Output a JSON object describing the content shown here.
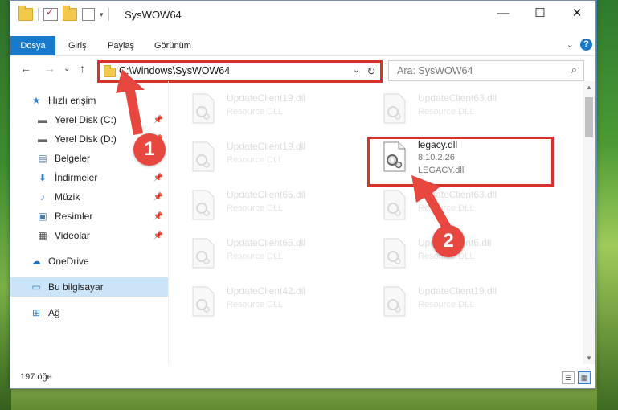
{
  "window": {
    "title": "SysWOW64",
    "controls": {
      "minimize": "—",
      "maximize": "☐",
      "close": "✕"
    }
  },
  "ribbon": {
    "tabs": [
      "Dosya",
      "Giriş",
      "Paylaş",
      "Görünüm"
    ],
    "expand_glyph": "⌄",
    "help_glyph": "?"
  },
  "navigation": {
    "back": "←",
    "forward": "→",
    "recent": "⌄",
    "up": "↑",
    "address": "C:\\Windows\\SysWOW64",
    "address_dropdown": "⌄",
    "refresh": "↻",
    "search_placeholder": "Ara: SysWOW64",
    "search_glyph": "⌕"
  },
  "sidebar": {
    "items": [
      {
        "label": "Hızlı erişim",
        "icon": "star-icon",
        "glyph": "★",
        "pinned": false,
        "selected": false
      },
      {
        "label": "Yerel Disk (C:)",
        "icon": "drive-icon",
        "glyph": "▬",
        "pinned": true,
        "selected": false
      },
      {
        "label": "Yerel Disk (D:)",
        "icon": "drive-icon",
        "glyph": "▬",
        "pinned": true,
        "selected": false
      },
      {
        "label": "Belgeler",
        "icon": "documents-icon",
        "glyph": "▤",
        "pinned": true,
        "selected": false
      },
      {
        "label": "İndirmeler",
        "icon": "downloads-icon",
        "glyph": "⬇",
        "pinned": true,
        "selected": false
      },
      {
        "label": "Müzik",
        "icon": "music-icon",
        "glyph": "♪",
        "pinned": true,
        "selected": false
      },
      {
        "label": "Resimler",
        "icon": "pictures-icon",
        "glyph": "▣",
        "pinned": true,
        "selected": false
      },
      {
        "label": "Videolar",
        "icon": "videos-icon",
        "glyph": "▦",
        "pinned": true,
        "selected": false
      },
      {
        "label": "OneDrive",
        "icon": "onedrive-icon",
        "glyph": "☁",
        "pinned": false,
        "selected": false
      },
      {
        "label": "Bu bilgisayar",
        "icon": "computer-icon",
        "glyph": "▭",
        "pinned": false,
        "selected": true
      },
      {
        "label": "Ağ",
        "icon": "network-icon",
        "glyph": "⊞",
        "pinned": false,
        "selected": false
      }
    ],
    "pin_glyph": "📌"
  },
  "files": {
    "left_column": [
      {
        "name": "UpdateClient19.dll",
        "desc": "Resource DLL"
      },
      {
        "name": "UpdateClient19.dll",
        "desc": "Resource DLL"
      },
      {
        "name": "UpdateClient65.dll",
        "desc": "Resource DLL"
      },
      {
        "name": "UpdateClient65.dll",
        "desc": "Resource DLL"
      },
      {
        "name": "UpdateClient42.dll",
        "desc": "Resource DLL"
      }
    ],
    "right_column": [
      {
        "name": "UpdateClient63.dll",
        "desc": "Resource DLL"
      },
      {
        "name": "UpdateClient63.dll",
        "desc": "Resource DLL"
      },
      {
        "name": "UpdateClient5.dll",
        "desc": "Resource DLL"
      },
      {
        "name": "UpdateClient19.dll",
        "desc": "Resource DLL"
      }
    ],
    "highlighted": {
      "name": "legacy.dll",
      "version": "8.10.2.26",
      "desc": "LEGACY.dll"
    }
  },
  "annotations": {
    "step1": "1",
    "step2": "2"
  },
  "status": {
    "count": "197 öğe",
    "view_details": "☰",
    "view_tiles": "▦"
  },
  "colors": {
    "accent": "#1979ca",
    "highlight_border": "#d9302c",
    "selected": "#cce4f7"
  }
}
